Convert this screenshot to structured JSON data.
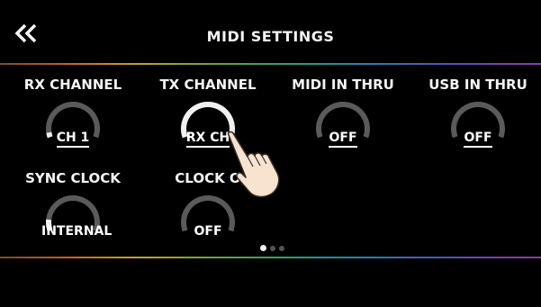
{
  "header": {
    "back_icon": "double-chevron-left-icon",
    "title": "MIDI SETTINGS"
  },
  "row1": [
    {
      "label": "RX CHANNEL",
      "value": "CH 1",
      "underline": true,
      "level": 0.05
    },
    {
      "label": "TX CHANNEL",
      "value": "RX CH",
      "underline": true,
      "level": 1.0
    },
    {
      "label": "MIDI IN THRU",
      "value": "OFF",
      "underline": true,
      "level": 0.0
    },
    {
      "label": "USB IN THRU",
      "value": "OFF",
      "underline": true,
      "level": 0.0
    }
  ],
  "row2": [
    {
      "label": "SYNC CLOCK",
      "value": "INTERNAL",
      "underline": false,
      "level": 0.12
    },
    {
      "label": "CLOCK O",
      "value": "OFF",
      "underline": false,
      "level": 0.0
    }
  ],
  "pagination": {
    "pages": 3,
    "current": 1
  },
  "pointer": "pointing-hand-icon",
  "colors": {
    "background": "#000000",
    "text": "#f4f4f4",
    "knob_track": "#5a5a5a",
    "knob_fill": "#f0f0f0"
  }
}
